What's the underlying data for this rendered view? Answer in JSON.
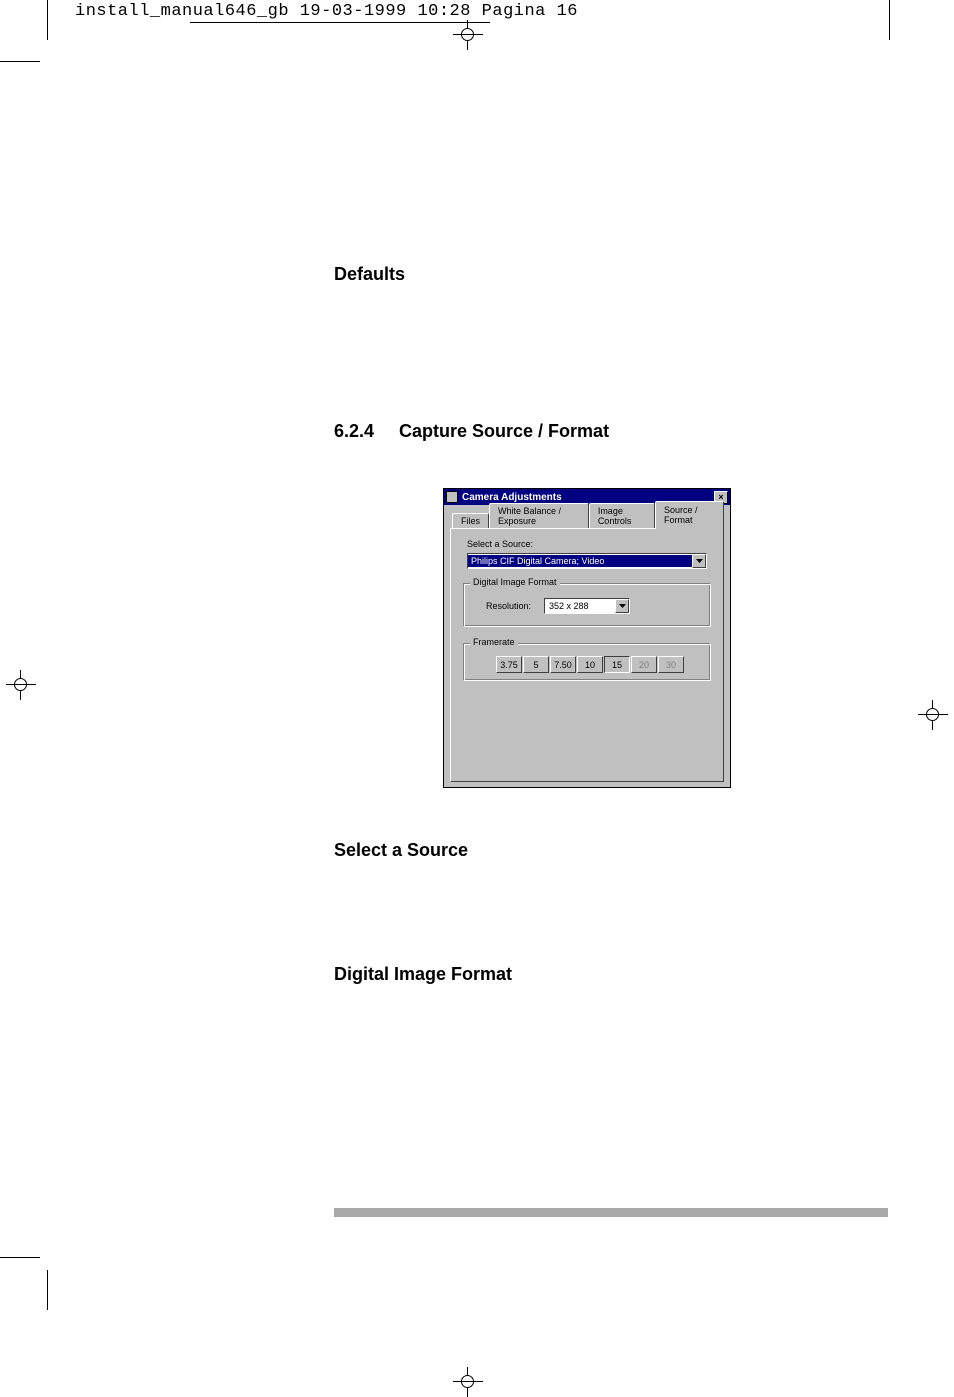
{
  "meta": {
    "crop_header": "install_manual646_gb  19-03-1999 10:28  Pagina 16"
  },
  "headings": {
    "defaults": "Defaults",
    "section_num": "6.2.4",
    "section_title": "Capture Source / Format",
    "select_source": "Select a Source",
    "dif": "Digital Image Format"
  },
  "dialog": {
    "title": "Camera Adjustments",
    "tabs": {
      "files": "Files",
      "wb": "White Balance / Exposure",
      "ic": "Image Controls",
      "sf": "Source / Format"
    },
    "select_label": "Select a Source:",
    "source_value": "Philips CIF Digital Camera; Video",
    "group_dif": "Digital Image Format",
    "res_label": "Resolution:",
    "res_value": "352 x 288",
    "group_fr": "Framerate",
    "fr": {
      "b0": "3.75",
      "b1": "5",
      "b2": "7.50",
      "b3": "10",
      "b4": "15",
      "b5": "20",
      "b6": "30"
    }
  }
}
